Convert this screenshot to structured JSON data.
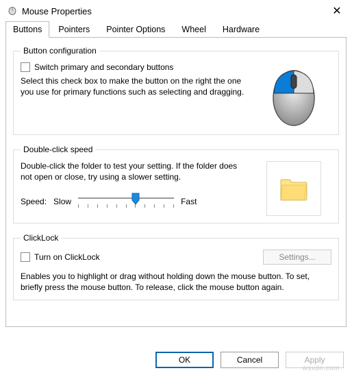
{
  "window": {
    "title": "Mouse Properties"
  },
  "tabs": {
    "buttons": "Buttons",
    "pointers": "Pointers",
    "pointer_options": "Pointer Options",
    "wheel": "Wheel",
    "hardware": "Hardware"
  },
  "button_config": {
    "legend": "Button configuration",
    "switch_label": "Switch primary and secondary buttons",
    "description": "Select this check box to make the button on the right the one you use for primary functions such as selecting and dragging."
  },
  "double_click": {
    "legend": "Double-click speed",
    "description": "Double-click the folder to test your setting. If the folder does not open or close, try using a slower setting.",
    "speed_label": "Speed:",
    "slow_label": "Slow",
    "fast_label": "Fast"
  },
  "clicklock": {
    "legend": "ClickLock",
    "turn_on_label": "Turn on ClickLock",
    "settings_btn": "Settings...",
    "description": "Enables you to highlight or drag without holding down the mouse button. To set, briefly press the mouse button. To release, click the mouse button again."
  },
  "buttons_bar": {
    "ok": "OK",
    "cancel": "Cancel",
    "apply": "Apply"
  },
  "watermark": "wsxdn.com"
}
